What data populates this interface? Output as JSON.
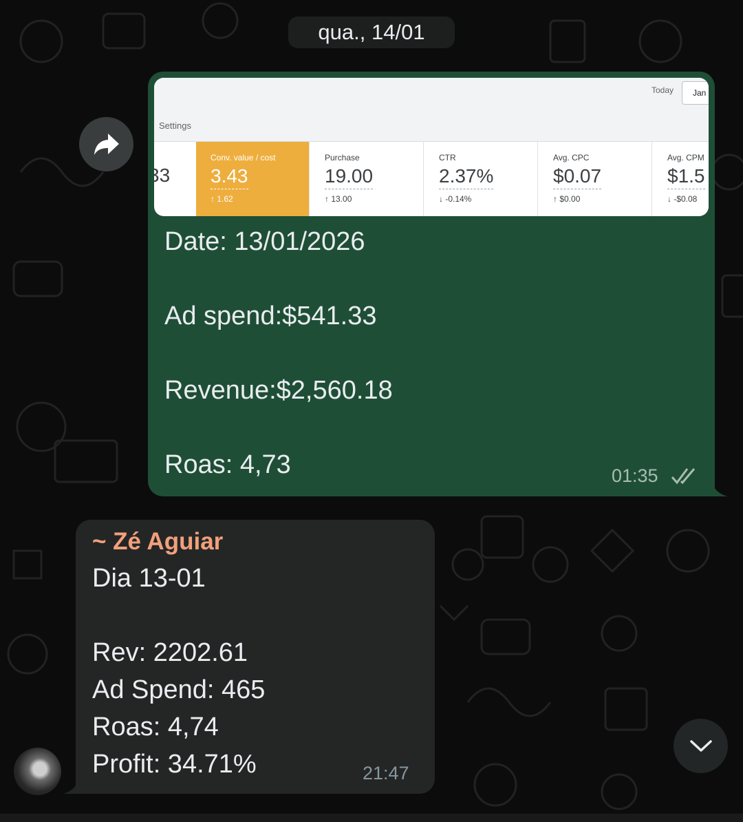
{
  "date_separator": "qua., 14/01",
  "outgoing_message": {
    "screenshot": {
      "settings_label": "Settings",
      "today_label": "Today",
      "date_button": "Jan",
      "partial_left_value": "33",
      "metrics": [
        {
          "label": "Conv. value / cost",
          "value": "3.43",
          "delta": "↑ 1.62",
          "active": true
        },
        {
          "label": "Purchase",
          "value": "19.00",
          "delta": "↑ 13.00"
        },
        {
          "label": "CTR",
          "value": "2.37%",
          "delta": "↓ -0.14%"
        },
        {
          "label": "Avg. CPC",
          "value": "$0.07",
          "delta": "↑ $0.00"
        },
        {
          "label": "Avg. CPM",
          "value": "$1.5",
          "delta": "↓ -$0.08"
        }
      ]
    },
    "lines": [
      "Date: 13/01/2026",
      "Ad spend:$541.33",
      "Revenue:$2,560.18",
      "Roas: 4,73"
    ],
    "time": "01:35",
    "status_icon": "double-check-icon"
  },
  "incoming_message": {
    "sender": "~ Zé Aguiar",
    "lines": [
      "Dia 13-01",
      "Rev: 2202.61",
      "Ad Spend: 465",
      "Roas: 4,74",
      "Profit: 34.71%"
    ],
    "time": "21:47"
  },
  "icons": {
    "forward": "forward-arrow-icon",
    "scroll": "chevron-down-icon"
  },
  "colors": {
    "outgoing_bubble": "#1f4e37",
    "incoming_bubble": "#242626",
    "sender_name": "#f2a07b",
    "highlight_metric": "#eeae3e"
  }
}
